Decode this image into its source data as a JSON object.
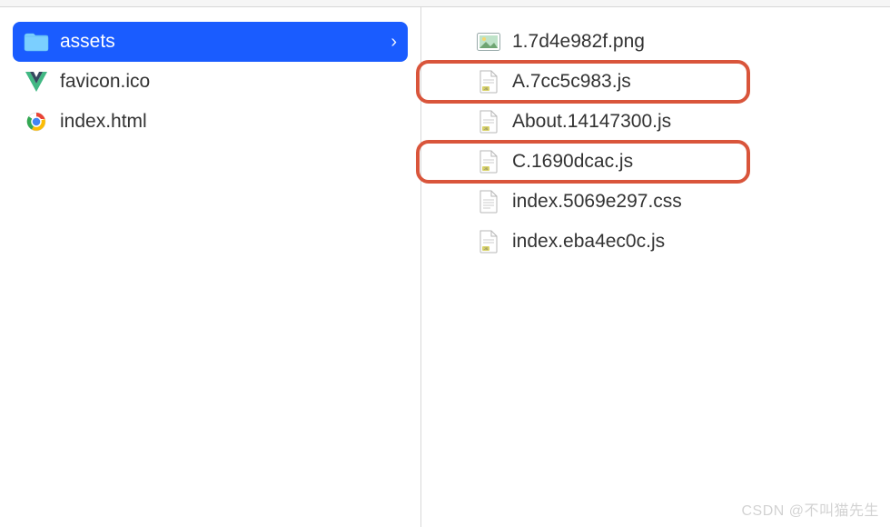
{
  "left": {
    "items": [
      {
        "name": "assets",
        "kind": "folder",
        "selected": true
      },
      {
        "name": "favicon.ico",
        "kind": "vue"
      },
      {
        "name": "index.html",
        "kind": "chrome"
      }
    ]
  },
  "right": {
    "items": [
      {
        "name": "1.7d4e982f.png",
        "kind": "image",
        "highlight": false
      },
      {
        "name": "A.7cc5c983.js",
        "kind": "js",
        "highlight": true
      },
      {
        "name": "About.14147300.js",
        "kind": "js",
        "highlight": false
      },
      {
        "name": "C.1690dcac.js",
        "kind": "js",
        "highlight": true
      },
      {
        "name": "index.5069e297.css",
        "kind": "css",
        "highlight": false
      },
      {
        "name": "index.eba4ec0c.js",
        "kind": "js",
        "highlight": false
      }
    ]
  },
  "watermark": "CSDN @不叫猫先生",
  "colors": {
    "selection": "#1a5cff",
    "highlight_border": "#d9553b"
  }
}
